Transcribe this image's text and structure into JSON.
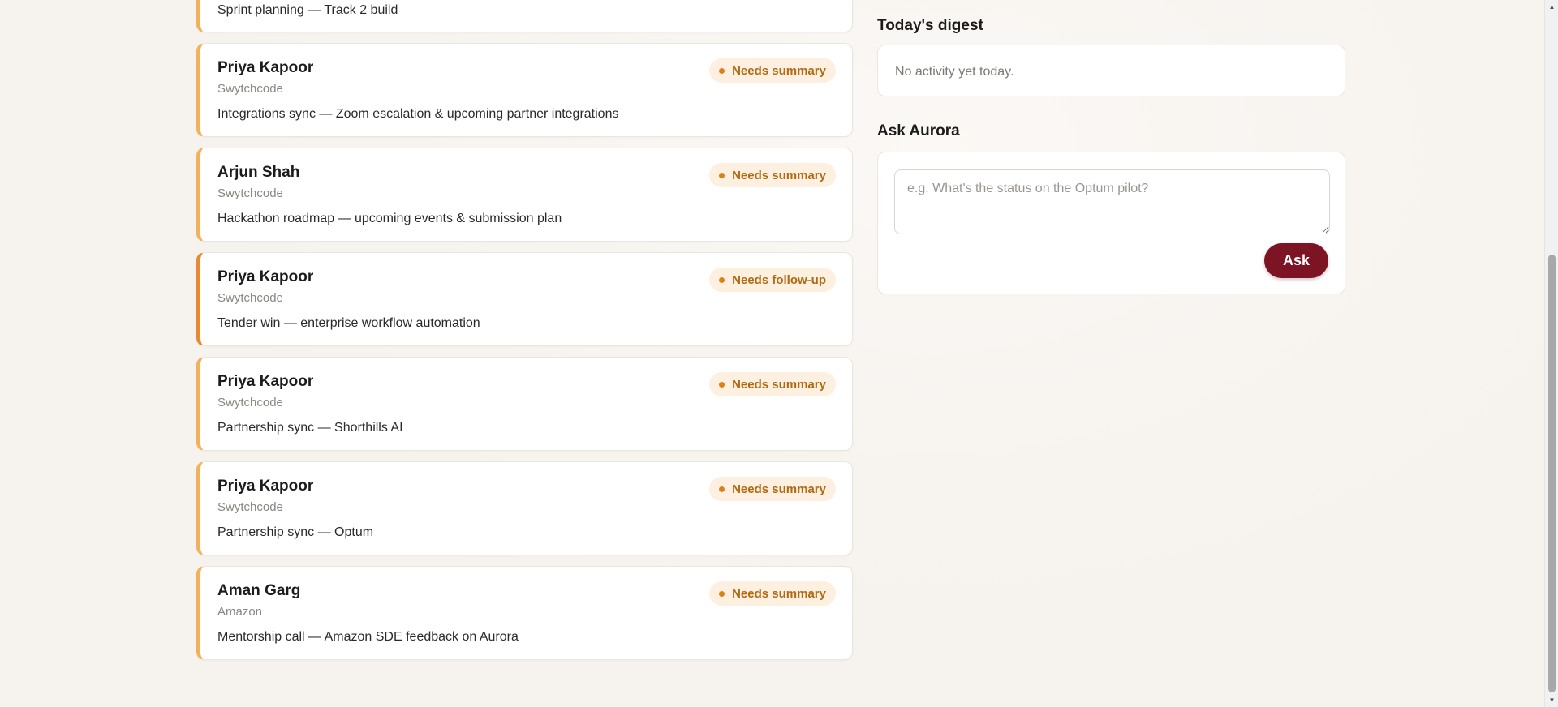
{
  "feed": {
    "partial_card": {
      "subject": "Sprint planning — Track 2 build"
    },
    "cards": [
      {
        "name": "Priya Kapoor",
        "company": "Swytchcode",
        "subject": "Integrations sync — Zoom escalation & upcoming partner integrations",
        "status": "Needs summary"
      },
      {
        "name": "Arjun Shah",
        "company": "Swytchcode",
        "subject": "Hackathon roadmap — upcoming events & submission plan",
        "status": "Needs summary"
      },
      {
        "name": "Priya Kapoor",
        "company": "Swytchcode",
        "subject": "Tender win — enterprise workflow automation",
        "status": "Needs follow-up"
      },
      {
        "name": "Priya Kapoor",
        "company": "Swytchcode",
        "subject": "Partnership sync — Shorthills AI",
        "status": "Needs summary"
      },
      {
        "name": "Priya Kapoor",
        "company": "Swytchcode",
        "subject": "Partnership sync — Optum",
        "status": "Needs summary"
      },
      {
        "name": "Aman Garg",
        "company": "Amazon",
        "subject": "Mentorship call — Amazon SDE feedback on Aurora",
        "status": "Needs summary"
      }
    ]
  },
  "digest": {
    "title": "Today's digest",
    "empty_text": "No activity yet today."
  },
  "ask": {
    "title": "Ask Aurora",
    "placeholder": "e.g. What's the status on the Optum pilot?",
    "button_label": "Ask"
  },
  "colors": {
    "accent": "#7d1424",
    "summary_border": "#f2b15a",
    "followup_border": "#ea8a30",
    "badge_bg": "#fdf0e1",
    "badge_text": "#b06a12"
  },
  "icons": {
    "badge_dot": "status-dot-icon",
    "scroll_up": "scroll-up-arrow-icon",
    "scroll_down": "scroll-down-arrow-icon"
  }
}
